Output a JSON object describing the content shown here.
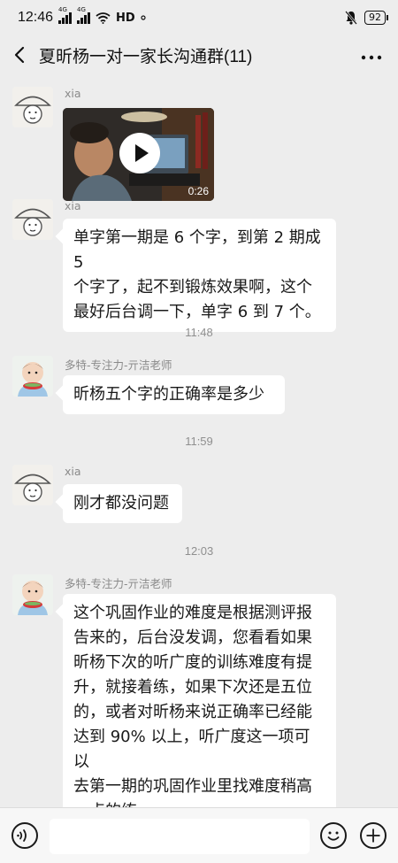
{
  "status_bar": {
    "time": "12:46",
    "signal1_tag": "4G",
    "signal2_tag": "4G",
    "hd_label": "HD",
    "battery": "92"
  },
  "header": {
    "title": "夏昕杨一对一家长沟通群(11)"
  },
  "messages": [
    {
      "sender": "xia",
      "duration": "0:26"
    },
    {
      "sender": "xia",
      "lines": [
        "单字第一期是 6 个字，到第 2 期成 5",
        "个字了，起不到锻炼效果啊，这个",
        "最好后台调一下，单字 6 到 7 个。"
      ]
    },
    {
      "sender": "多特-专注力-亓洁老师",
      "lines": [
        "昕杨五个字的正确率是多少"
      ]
    },
    {
      "sender": "xia",
      "lines": [
        "刚才都没问题"
      ]
    },
    {
      "sender": "多特-专注力-亓洁老师",
      "lines": [
        "这个巩固作业的难度是根据测评报",
        "告来的，后台没发调，您看看如果",
        "昕杨下次的听广度的训练难度有提",
        "升，就接着练，如果下次还是五位",
        "的，或者对昕杨来说正确率已经能",
        "达到 90% 以上，听广度这一项可以",
        "去第一期的巩固作业里找难度稍高",
        "一点的练"
      ]
    }
  ],
  "timestamps": [
    "11:48",
    "11:59",
    "12:03"
  ],
  "icons": {
    "back": "back-arrow-icon",
    "more": "more-icon",
    "voice": "voice-icon",
    "emoji": "emoji-icon",
    "add": "plus-icon",
    "play": "play-icon"
  },
  "colors": {
    "background": "#ededed",
    "bubble": "#ffffff",
    "meta_text": "#8a8a8a"
  }
}
